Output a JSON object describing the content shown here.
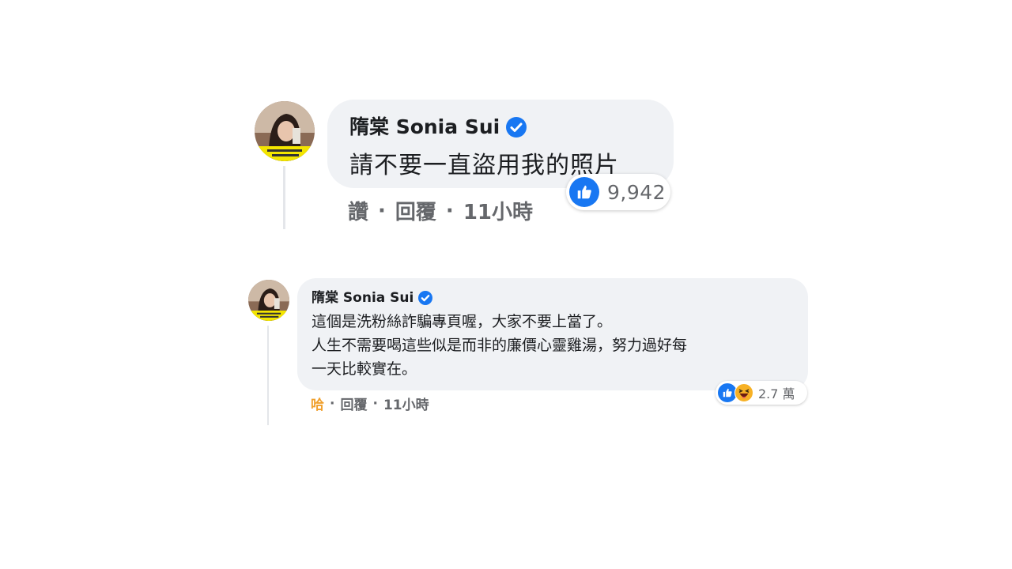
{
  "colors": {
    "bubble_bg": "#f0f2f5",
    "accent_blue": "#1877f2",
    "meta_gray": "#65676b",
    "haha_orange": "#f0a02d",
    "avatar_badge_yellow": "#f3e500"
  },
  "comments": [
    {
      "author": "隋棠 Sonia Sui",
      "verified_icon": "verified-check-icon",
      "text": "請不要一直盜用我的照片",
      "reactions": {
        "icons": [
          "like-icon"
        ],
        "count": "9,942"
      },
      "actions": {
        "reaction_label": "讚",
        "reply_label": "回覆",
        "time": "11小時",
        "separator": "·"
      }
    },
    {
      "author": "隋棠 Sonia Sui",
      "verified_icon": "verified-check-icon",
      "text_lines": [
        "這個是洗粉絲詐騙專頁喔，大家不要上當了。",
        "人生不需要喝這些似是而非的廉價心靈雞湯，努力過好每",
        "一天比較實在。"
      ],
      "reactions": {
        "icons": [
          "like-icon",
          "haha-icon"
        ],
        "count": "2.7 萬"
      },
      "actions": {
        "reaction_label": "哈",
        "reply_label": "回覆",
        "time": "11小時",
        "separator": "·"
      }
    }
  ]
}
